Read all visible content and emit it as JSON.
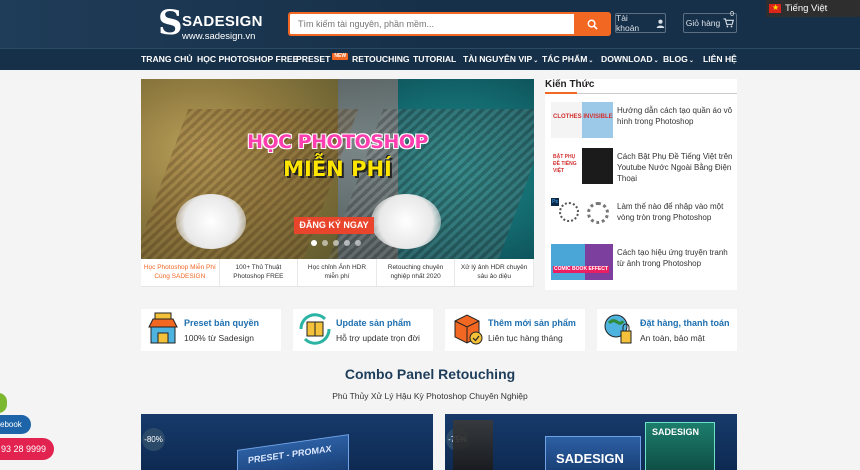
{
  "brand": {
    "name": "SADESIGN",
    "url": "www.sadesign.vn"
  },
  "search": {
    "placeholder": "Tìm kiếm tài nguyên, phần mềm..."
  },
  "header": {
    "account_label": "Tài khoản",
    "cart_label": "Giỏ hàng",
    "cart_count": "0",
    "language": "Tiếng Việt"
  },
  "nav": {
    "items": [
      {
        "label": "TRANG CHỦ"
      },
      {
        "label": "HỌC PHOTOSHOP FREE"
      },
      {
        "label": "PRESET",
        "badge": "NEW"
      },
      {
        "label": "RETOUCHING"
      },
      {
        "label": "TUTORIAL"
      },
      {
        "label": "TÀI NGUYÊN VIP"
      },
      {
        "label": "TÁC PHẨM"
      },
      {
        "label": "DOWNLOAD"
      },
      {
        "label": "BLOG"
      },
      {
        "label": "LIÊN HỆ"
      }
    ]
  },
  "slider": {
    "title_line1": "HỌC PHOTOSHOP",
    "title_line2": "MIỄN PHÍ",
    "cta": "ĐĂNG KÝ NGAY",
    "tabs": [
      {
        "label": "Học Photoshop Miễn Phí Cùng SADESIGN"
      },
      {
        "label": "100+ Thủ Thuật Photoshop FREE"
      },
      {
        "label": "Học chỉnh Ảnh HDR miễn phí"
      },
      {
        "label": "Retouching chuyên nghiệp nhất 2020"
      },
      {
        "label": "Xử lý ảnh HDR chuyên sâu ảo diệu"
      }
    ]
  },
  "knowledge": {
    "title": "Kiến Thức",
    "items": [
      {
        "text": "Hướng dẫn cách tạo quần áo vô hình trong Photoshop",
        "thumb_text": "CLOTHES INVISIBLE"
      },
      {
        "text": "Cách Bật Phụ Đề Tiếng Việt trên Youtube Nước Ngoài Bằng Điện Thoại",
        "thumb_text": "BẬT PHỤ ĐỀ TIẾNG VIỆT"
      },
      {
        "text": "Làm thế nào để nhập vào một vòng tròn trong Photoshop",
        "thumb_text": "Ps"
      },
      {
        "text": "Cách tạo hiệu ứng truyện tranh từ ảnh trong Photoshop",
        "thumb_text": "COMIC BOOK EFFECT"
      }
    ]
  },
  "features": [
    {
      "title": "Preset bản quyền",
      "subtitle": "100% từ Sadesign"
    },
    {
      "title": "Update sản phẩm",
      "subtitle": "Hỗ trợ update trọn đời"
    },
    {
      "title": "Thêm mới sản phẩm",
      "subtitle": "Liên tục hàng tháng"
    },
    {
      "title": "Đặt hàng, thanh toán",
      "subtitle": "An toàn, bảo mật"
    }
  ],
  "combo": {
    "title": "Combo Panel Retouching",
    "subtitle": "Phù Thủy Xử Lý Hậu Kỳ Photoshop Chuyên Nghiệp",
    "products": [
      {
        "discount": "-80%",
        "box_text": "PRESET - PROMAX"
      },
      {
        "discount": "-75%",
        "box_text": "SADESIGN"
      }
    ]
  },
  "floating": {
    "facebook": "ebook",
    "phone": "93 28 9999"
  },
  "colors": {
    "header_bg": "#173049",
    "accent": "#f26722",
    "feature_title": "#1d6fb0"
  }
}
